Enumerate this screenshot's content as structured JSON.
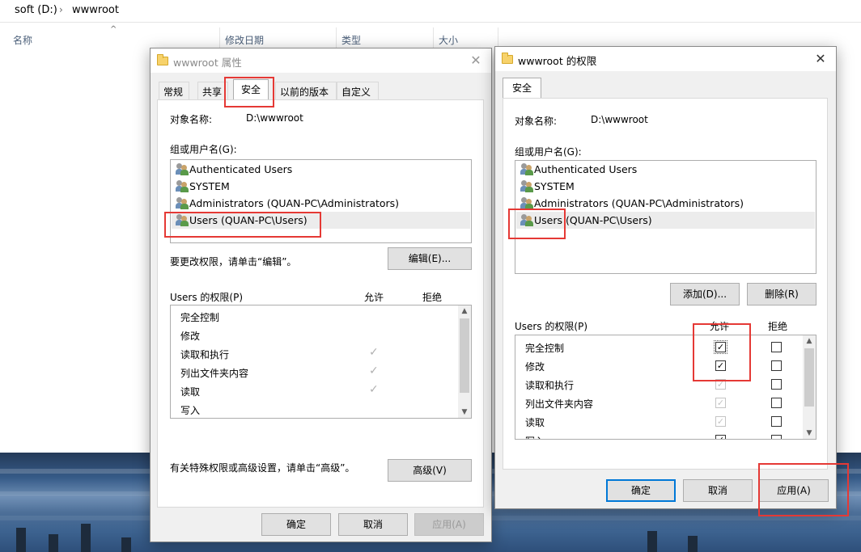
{
  "explorer": {
    "breadcrumb": [
      "soft (D:)",
      "wwwroot"
    ],
    "columns": [
      "名称",
      "修改日期",
      "类型",
      "大小"
    ]
  },
  "props_dialog": {
    "title": "wwwroot 属性",
    "tabs": [
      "常规",
      "共享",
      "安全",
      "以前的版本",
      "自定义"
    ],
    "active_tab": "安全",
    "object_label": "对象名称:",
    "object_value": "D:\\wwwroot",
    "group_label": "组或用户名(G):",
    "users": [
      "Authenticated Users",
      "SYSTEM",
      "Administrators (QUAN-PC\\Administrators)",
      "Users (QUAN-PC\\Users)"
    ],
    "selected_user": "Users (QUAN-PC\\Users)",
    "edit_hint": "要更改权限，请单击“编辑”。",
    "edit_button": "编辑(E)...",
    "perm_label": "Users 的权限(P)",
    "allow_header": "允许",
    "deny_header": "拒绝",
    "permissions": [
      {
        "name": "完全控制",
        "allow": false,
        "deny": false
      },
      {
        "name": "修改",
        "allow": false,
        "deny": false
      },
      {
        "name": "读取和执行",
        "allow": true,
        "deny": false
      },
      {
        "name": "列出文件夹内容",
        "allow": true,
        "deny": false
      },
      {
        "name": "读取",
        "allow": true,
        "deny": false
      },
      {
        "name": "写入",
        "allow": false,
        "deny": false
      }
    ],
    "advanced_hint": "有关特殊权限或高级设置，请单击“高级”。",
    "advanced_button": "高级(V)",
    "ok_button": "确定",
    "cancel_button": "取消",
    "apply_button": "应用(A)"
  },
  "perm_dialog": {
    "title": "wwwroot 的权限",
    "tab": "安全",
    "object_label": "对象名称:",
    "object_value": "D:\\wwwroot",
    "group_label": "组或用户名(G):",
    "users": [
      "Authenticated Users",
      "SYSTEM",
      "Administrators (QUAN-PC\\Administrators)",
      "Users (QUAN-PC\\Users)"
    ],
    "selected_user": "Users (QUAN-PC\\Users)",
    "add_button": "添加(D)...",
    "remove_button": "删除(R)",
    "perm_label": "Users 的权限(P)",
    "allow_header": "允许",
    "deny_header": "拒绝",
    "permissions": [
      {
        "name": "完全控制",
        "allow": true,
        "allow_disabled": false,
        "deny": false
      },
      {
        "name": "修改",
        "allow": true,
        "allow_disabled": false,
        "deny": false
      },
      {
        "name": "读取和执行",
        "allow": true,
        "allow_disabled": true,
        "deny": false
      },
      {
        "name": "列出文件夹内容",
        "allow": true,
        "allow_disabled": true,
        "deny": false
      },
      {
        "name": "读取",
        "allow": true,
        "allow_disabled": true,
        "deny": false
      },
      {
        "name": "写入",
        "allow": true,
        "allow_disabled": false,
        "deny": false
      }
    ],
    "ok_button": "确定",
    "cancel_button": "取消",
    "apply_button": "应用(A)"
  },
  "highlight_color": "#e53935"
}
